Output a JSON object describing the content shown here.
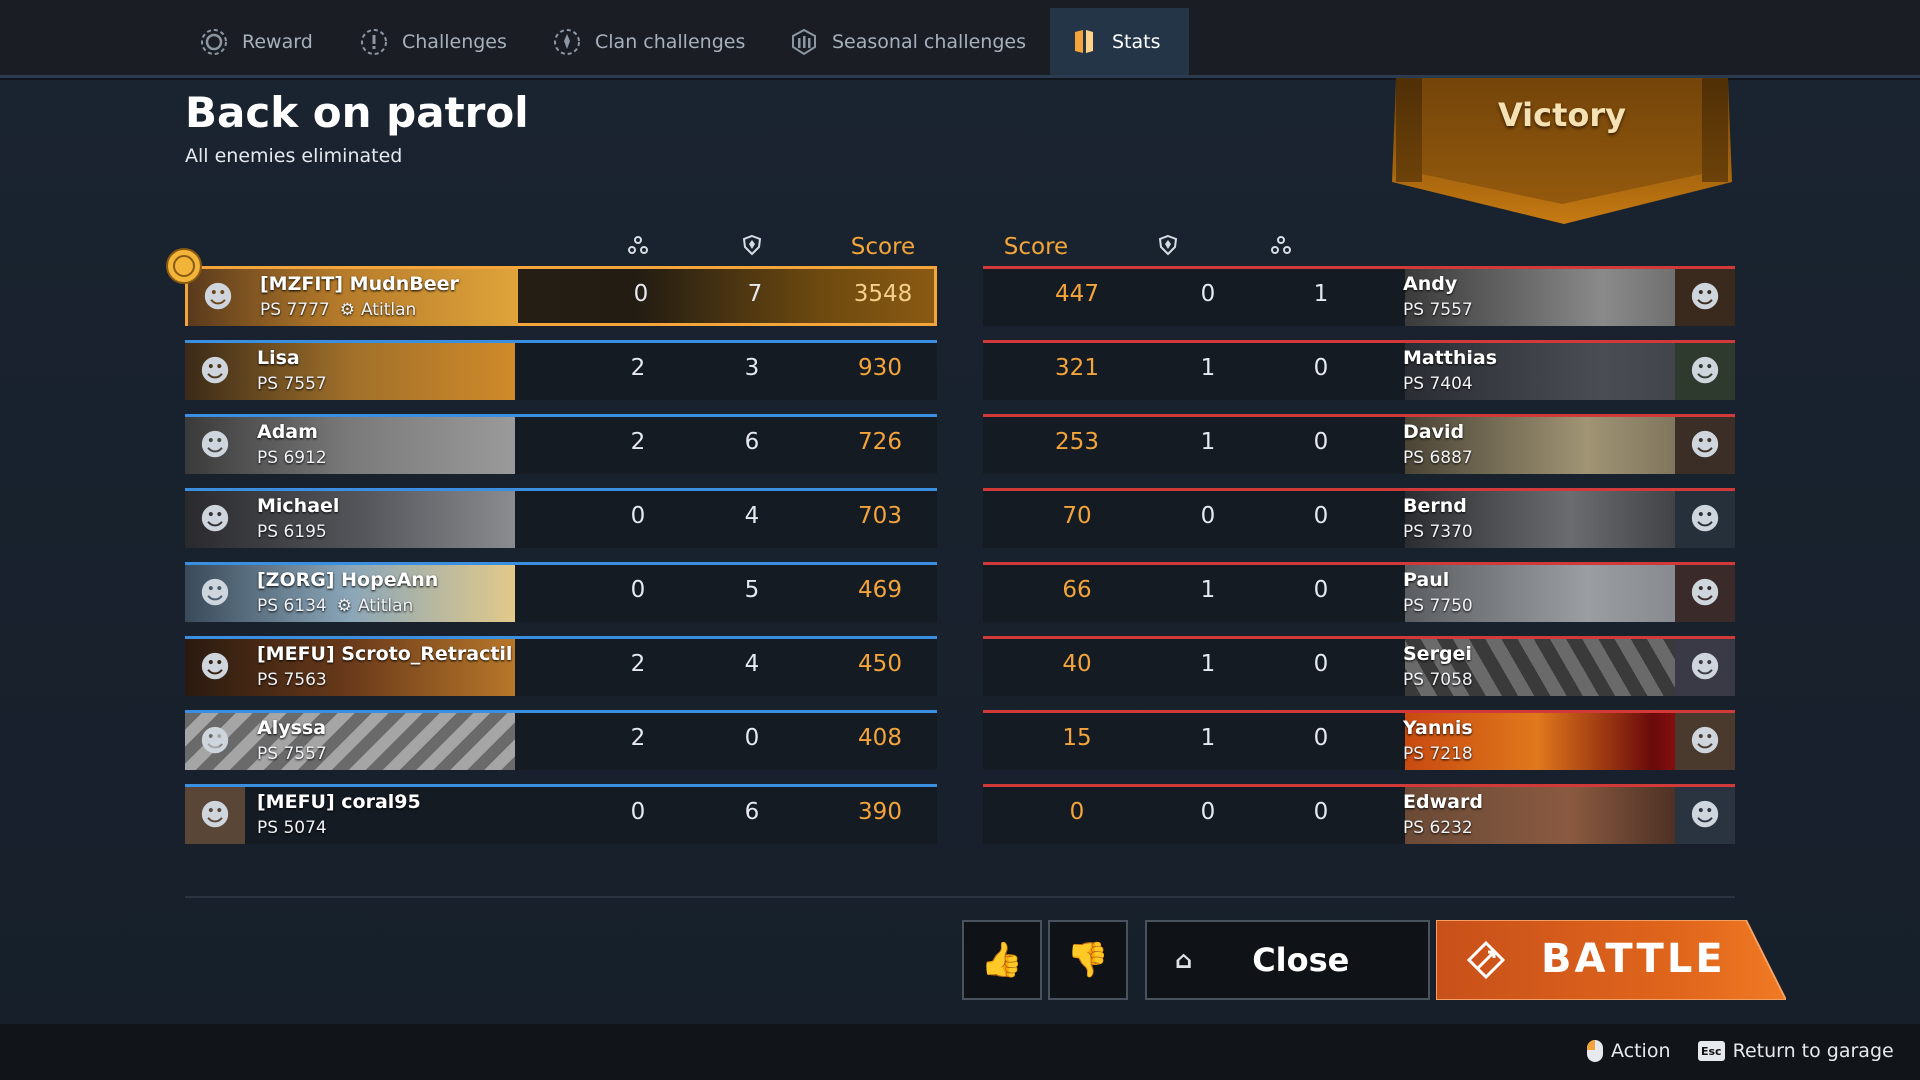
{
  "tabs": [
    {
      "label": "Reward",
      "icon": "reward-icon"
    },
    {
      "label": "Challenges",
      "icon": "challenges-icon"
    },
    {
      "label": "Clan challenges",
      "icon": "clan-challenges-icon"
    },
    {
      "label": "Seasonal challenges",
      "icon": "seasonal-challenges-icon"
    },
    {
      "label": "Stats",
      "icon": "stats-icon",
      "active": true
    }
  ],
  "header": {
    "title": "Back on patrol",
    "subtitle": "All enemies eliminated",
    "result": "Victory"
  },
  "columns": {
    "kills_icon": "kills-icon",
    "assists_icon": "shield-icon",
    "score_label": "Score"
  },
  "team_left": [
    {
      "name": "[MZFIT] MudnBeer",
      "rating": "PS 7777",
      "clan": "Atitlan",
      "kills": "0",
      "assists": "7",
      "score": "3548",
      "highlight": true
    },
    {
      "name": "Lisa",
      "rating": "PS 7557",
      "kills": "2",
      "assists": "3",
      "score": "930"
    },
    {
      "name": "Adam",
      "rating": "PS 6912",
      "kills": "2",
      "assists": "6",
      "score": "726"
    },
    {
      "name": "Michael",
      "rating": "PS 6195",
      "kills": "0",
      "assists": "4",
      "score": "703"
    },
    {
      "name": "[ZORG] HopeAnn",
      "rating": "PS 6134",
      "clan": "Atitlan",
      "kills": "0",
      "assists": "5",
      "score": "469"
    },
    {
      "name": "[MEFU] Scroto_Retractil",
      "rating": "PS 7563",
      "kills": "2",
      "assists": "4",
      "score": "450"
    },
    {
      "name": "Alyssa",
      "rating": "PS 7557",
      "kills": "2",
      "assists": "0",
      "score": "408"
    },
    {
      "name": "[MEFU] coral95",
      "rating": "PS 5074",
      "kills": "0",
      "assists": "6",
      "score": "390"
    }
  ],
  "team_right": [
    {
      "name": "Andy",
      "rating": "PS 7557",
      "score": "447",
      "assists": "0",
      "kills": "1"
    },
    {
      "name": "Matthias",
      "rating": "PS 7404",
      "score": "321",
      "assists": "1",
      "kills": "0"
    },
    {
      "name": "David",
      "rating": "PS 6887",
      "score": "253",
      "assists": "1",
      "kills": "0"
    },
    {
      "name": "Bernd",
      "rating": "PS 7370",
      "score": "70",
      "assists": "0",
      "kills": "0"
    },
    {
      "name": "Paul",
      "rating": "PS 7750",
      "score": "66",
      "assists": "1",
      "kills": "0"
    },
    {
      "name": "Sergei",
      "rating": "PS 7058",
      "score": "40",
      "assists": "1",
      "kills": "0"
    },
    {
      "name": "Yannis",
      "rating": "PS 7218",
      "score": "15",
      "assists": "1",
      "kills": "0"
    },
    {
      "name": "Edward",
      "rating": "PS 6232",
      "score": "0",
      "assists": "0",
      "kills": "0"
    }
  ],
  "actions": {
    "like_icon": "thumbs-up-icon",
    "dislike_icon": "thumbs-down-icon",
    "close_label": "Close",
    "battle_label": "BATTLE"
  },
  "footer": {
    "action_label": "Action",
    "esc_key": "Esc",
    "return_label": "Return to garage"
  },
  "colors": {
    "accent": "#f3a43a",
    "ally": "#3a8fe0",
    "enemy": "#d23a3a",
    "battle": "#e0661c"
  }
}
